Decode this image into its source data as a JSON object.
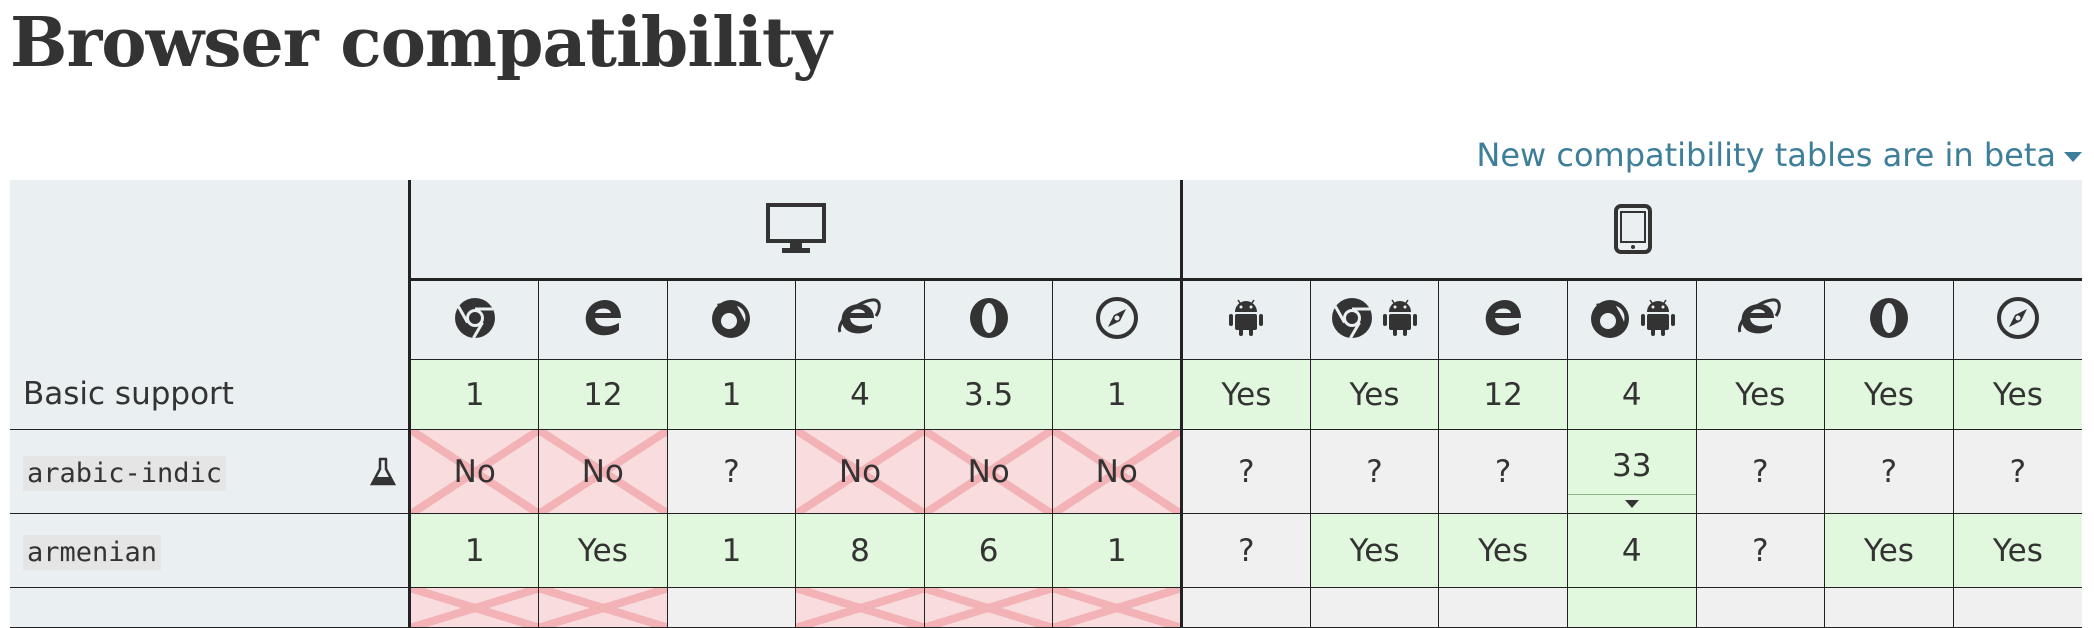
{
  "page": {
    "title": "Browser compatibility",
    "beta_link": "New compatibility tables are in beta"
  },
  "platforms": [
    {
      "name": "desktop",
      "icon": "desktop-icon"
    },
    {
      "name": "mobile",
      "icon": "tablet-icon"
    }
  ],
  "browsers": [
    {
      "id": "chrome",
      "icon": "chrome-icon"
    },
    {
      "id": "edge",
      "icon": "edge-icon"
    },
    {
      "id": "firefox",
      "icon": "firefox-icon"
    },
    {
      "id": "ie",
      "icon": "internet-explorer-icon"
    },
    {
      "id": "opera",
      "icon": "opera-icon"
    },
    {
      "id": "safari",
      "icon": "safari-icon"
    },
    {
      "id": "webview_android",
      "icon": "android-icon"
    },
    {
      "id": "chrome_android",
      "icon": "chrome-android-icon"
    },
    {
      "id": "edge_mobile",
      "icon": "edge-icon"
    },
    {
      "id": "firefox_android",
      "icon": "firefox-android-icon"
    },
    {
      "id": "ie_mobile",
      "icon": "internet-explorer-icon"
    },
    {
      "id": "opera_android",
      "icon": "opera-icon"
    },
    {
      "id": "safari_ios",
      "icon": "safari-icon"
    }
  ],
  "rows": [
    {
      "feature": "Basic support",
      "code": false,
      "cells": [
        {
          "v": "1",
          "s": "yes"
        },
        {
          "v": "12",
          "s": "yes"
        },
        {
          "v": "1",
          "s": "yes"
        },
        {
          "v": "4",
          "s": "yes"
        },
        {
          "v": "3.5",
          "s": "yes"
        },
        {
          "v": "1",
          "s": "yes"
        },
        {
          "v": "Yes",
          "s": "yes"
        },
        {
          "v": "Yes",
          "s": "yes"
        },
        {
          "v": "12",
          "s": "yes"
        },
        {
          "v": "4",
          "s": "yes"
        },
        {
          "v": "Yes",
          "s": "yes"
        },
        {
          "v": "Yes",
          "s": "yes"
        },
        {
          "v": "Yes",
          "s": "yes"
        }
      ]
    },
    {
      "feature": "arabic-indic",
      "code": true,
      "experimental": true,
      "cells": [
        {
          "v": "No",
          "s": "no"
        },
        {
          "v": "No",
          "s": "no"
        },
        {
          "v": "?",
          "s": "unknown"
        },
        {
          "v": "No",
          "s": "no"
        },
        {
          "v": "No",
          "s": "no"
        },
        {
          "v": "No",
          "s": "no"
        },
        {
          "v": "?",
          "s": "unknown"
        },
        {
          "v": "?",
          "s": "unknown"
        },
        {
          "v": "?",
          "s": "unknown"
        },
        {
          "v": "33",
          "s": "yes",
          "expand": true
        },
        {
          "v": "?",
          "s": "unknown"
        },
        {
          "v": "?",
          "s": "unknown"
        },
        {
          "v": "?",
          "s": "unknown"
        }
      ]
    },
    {
      "feature": "armenian",
      "code": true,
      "cells": [
        {
          "v": "1",
          "s": "yes"
        },
        {
          "v": "Yes",
          "s": "yes"
        },
        {
          "v": "1",
          "s": "yes"
        },
        {
          "v": "8",
          "s": "yes"
        },
        {
          "v": "6",
          "s": "yes"
        },
        {
          "v": "1",
          "s": "yes"
        },
        {
          "v": "?",
          "s": "unknown"
        },
        {
          "v": "Yes",
          "s": "yes"
        },
        {
          "v": "Yes",
          "s": "yes"
        },
        {
          "v": "4",
          "s": "yes"
        },
        {
          "v": "?",
          "s": "unknown"
        },
        {
          "v": "Yes",
          "s": "yes"
        },
        {
          "v": "Yes",
          "s": "yes"
        }
      ]
    },
    {
      "feature": "",
      "code": false,
      "cells": [
        {
          "v": "",
          "s": "no"
        },
        {
          "v": "",
          "s": "no"
        },
        {
          "v": "",
          "s": "unknown"
        },
        {
          "v": "",
          "s": "no"
        },
        {
          "v": "",
          "s": "no"
        },
        {
          "v": "",
          "s": "no"
        },
        {
          "v": "",
          "s": "unknown"
        },
        {
          "v": "",
          "s": "unknown"
        },
        {
          "v": "",
          "s": "unknown"
        },
        {
          "v": "",
          "s": "yes"
        },
        {
          "v": "",
          "s": "unknown"
        },
        {
          "v": "",
          "s": "unknown"
        },
        {
          "v": "",
          "s": "unknown"
        }
      ]
    }
  ],
  "colors": {
    "link": "#3d7e9a",
    "header_bg": "#eaeff2",
    "yes_bg": "#e2f8de",
    "no_bg": "#f9dcdd",
    "no_cross": "#f2b2b6",
    "unknown_bg": "#f0f0f0"
  }
}
